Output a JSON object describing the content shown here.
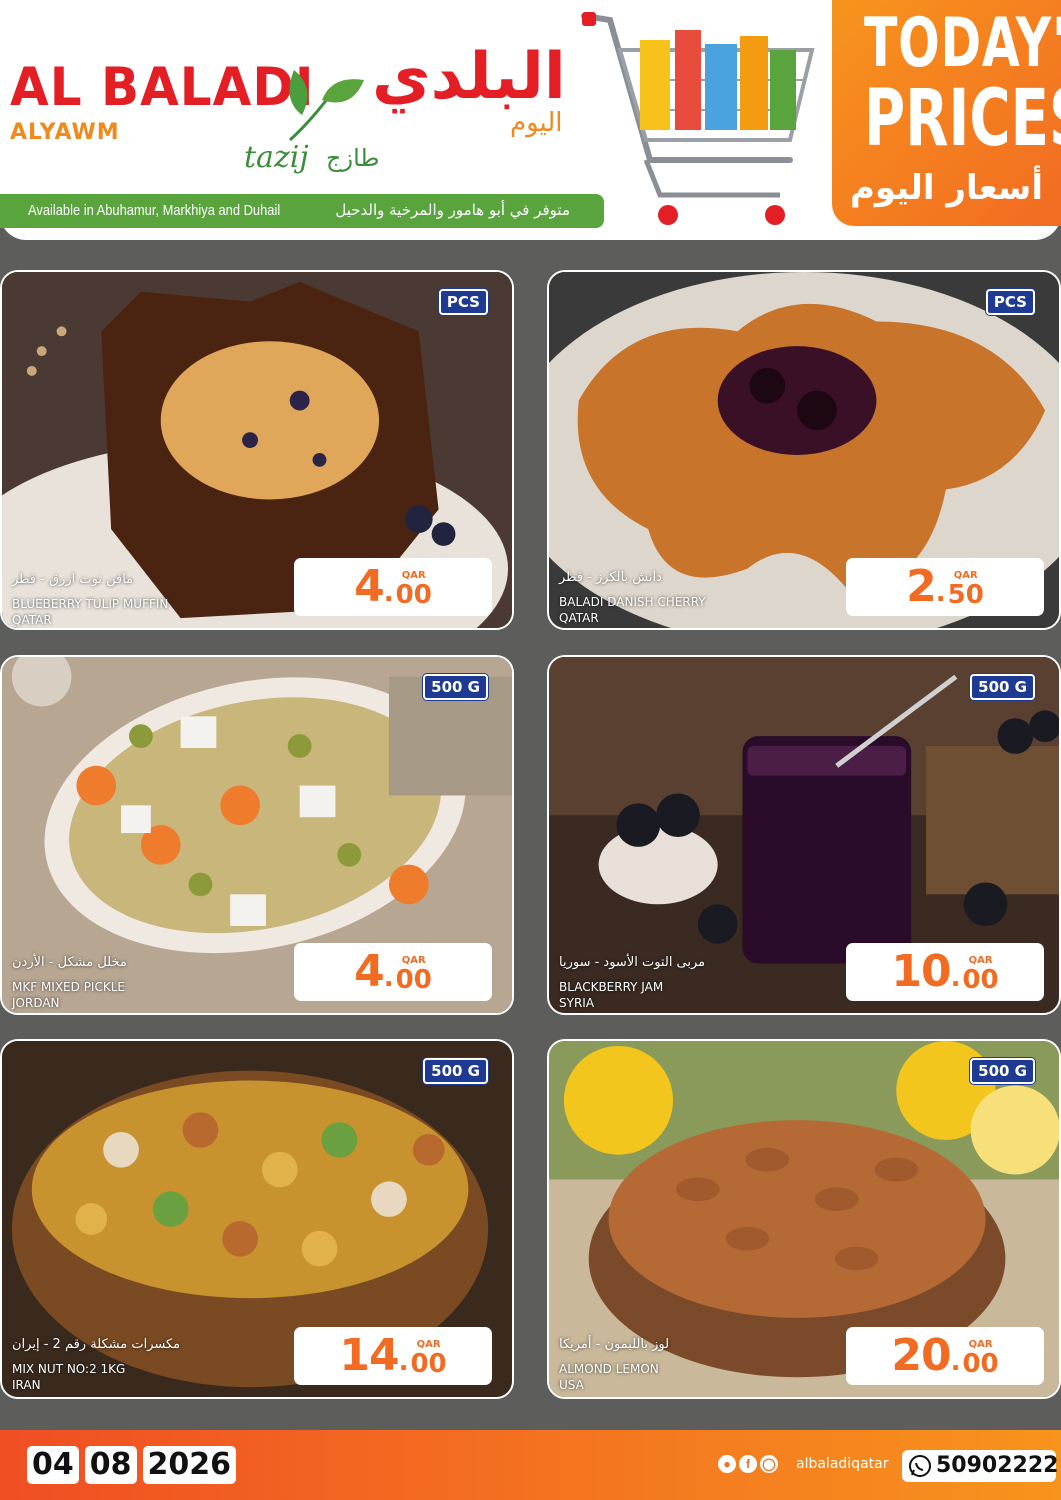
{
  "header": {
    "brand_en": "AL BALADI",
    "brand_sub": "ALYAWM",
    "brand_ar": "البلدي",
    "brand_ar_sub": "اليوم",
    "tazij_en": "tazij",
    "tazij_ar": "طازج",
    "available_en": "Available in Abuhamur, Markhiya and Duhail",
    "available_ar": "متوفر في أبو هامور والمرخية والدحيل",
    "today_line1": "TODAY'S",
    "today_line2": "PRICES",
    "today_ar": "أسعار اليوم"
  },
  "products": [
    {
      "unit": "PCS",
      "name_ar": "مافن توت ازرق - قطر",
      "name_en": "BLUEBERRY TULIP MUFFIN",
      "origin": "QATAR",
      "currency": "QAR",
      "price_int": "4",
      "price_dec": "00"
    },
    {
      "unit": "PCS",
      "name_ar": "دانش بالكرز - قطر",
      "name_en": "BALADI DANISH CHERRY",
      "origin": "QATAR",
      "currency": "QAR",
      "price_int": "2",
      "price_dec": "50"
    },
    {
      "unit": "500 G",
      "name_ar": "مخلل مشكل - الأردن",
      "name_en": "MKF MIXED PICKLE",
      "origin": "JORDAN",
      "currency": "QAR",
      "price_int": "4",
      "price_dec": "00"
    },
    {
      "unit": "500 G",
      "name_ar": "مربى التوت الأسود - سوريا",
      "name_en": "BLACKBERRY JAM",
      "origin": "SYRIA",
      "currency": "QAR",
      "price_int": "10",
      "price_dec": "00"
    },
    {
      "unit": "500 G",
      "name_ar": "مكسرات مشكلة رقم 2 - إيران",
      "name_en": "MIX NUT NO:2 1KG",
      "origin": "IRAN",
      "currency": "QAR",
      "price_int": "14",
      "price_dec": "00"
    },
    {
      "unit": "500 G",
      "name_ar": "لوز بالليمون - أمريكا",
      "name_en": "ALMOND LEMON",
      "origin": "USA",
      "currency": "QAR",
      "price_int": "20",
      "price_dec": "00"
    }
  ],
  "footer": {
    "date_day": "04",
    "date_month": "08",
    "date_year": "2026",
    "social_handle": "albaladiqatar",
    "phone": "50902222"
  },
  "colors": {
    "brand_red": "#e31e25",
    "brand_orange": "#f26b22",
    "brand_green": "#5aa43e",
    "unit_badge_blue": "#1f3a93"
  },
  "icons": [
    "leaf-logo-icon",
    "shopping-cart-icon",
    "snapchat-icon",
    "facebook-icon",
    "instagram-icon",
    "whatsapp-icon"
  ]
}
